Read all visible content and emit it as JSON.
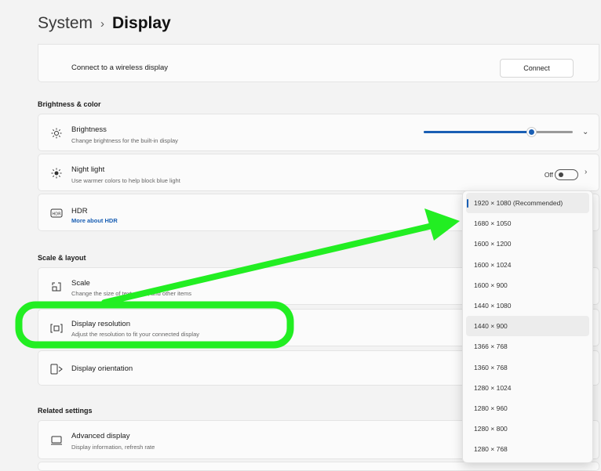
{
  "breadcrumb": {
    "parent": "System",
    "separator": "›",
    "current": "Display"
  },
  "wireless": {
    "label": "Connect to a wireless display",
    "button": "Connect"
  },
  "sections": {
    "brightness": "Brightness & color",
    "scale": "Scale & layout",
    "related": "Related settings"
  },
  "brightness": {
    "title": "Brightness",
    "subtitle": "Change brightness for the built-in display",
    "level": 0.72
  },
  "night_light": {
    "title": "Night light",
    "subtitle": "Use warmer colors to help block blue light",
    "state": "Off"
  },
  "hdr": {
    "title": "HDR",
    "link": "More about HDR"
  },
  "scale": {
    "title": "Scale",
    "subtitle": "Change the size of text, apps, and other items"
  },
  "resolution": {
    "title": "Display resolution",
    "subtitle": "Adjust the resolution to fit your connected display"
  },
  "orientation": {
    "title": "Display orientation"
  },
  "advanced": {
    "title": "Advanced display",
    "subtitle": "Display information, refresh rate"
  },
  "resolution_options": [
    "1920 × 1080 (Recommended)",
    "1680 × 1050",
    "1600 × 1200",
    "1600 × 1024",
    "1600 × 900",
    "1440 × 1080",
    "1440 × 900",
    "1366 × 768",
    "1360 × 768",
    "1280 × 1024",
    "1280 × 960",
    "1280 × 800",
    "1280 × 768"
  ],
  "selected_option_index": 0,
  "colors": {
    "accent": "#1a5fb4",
    "annotation": "#22ee22"
  }
}
